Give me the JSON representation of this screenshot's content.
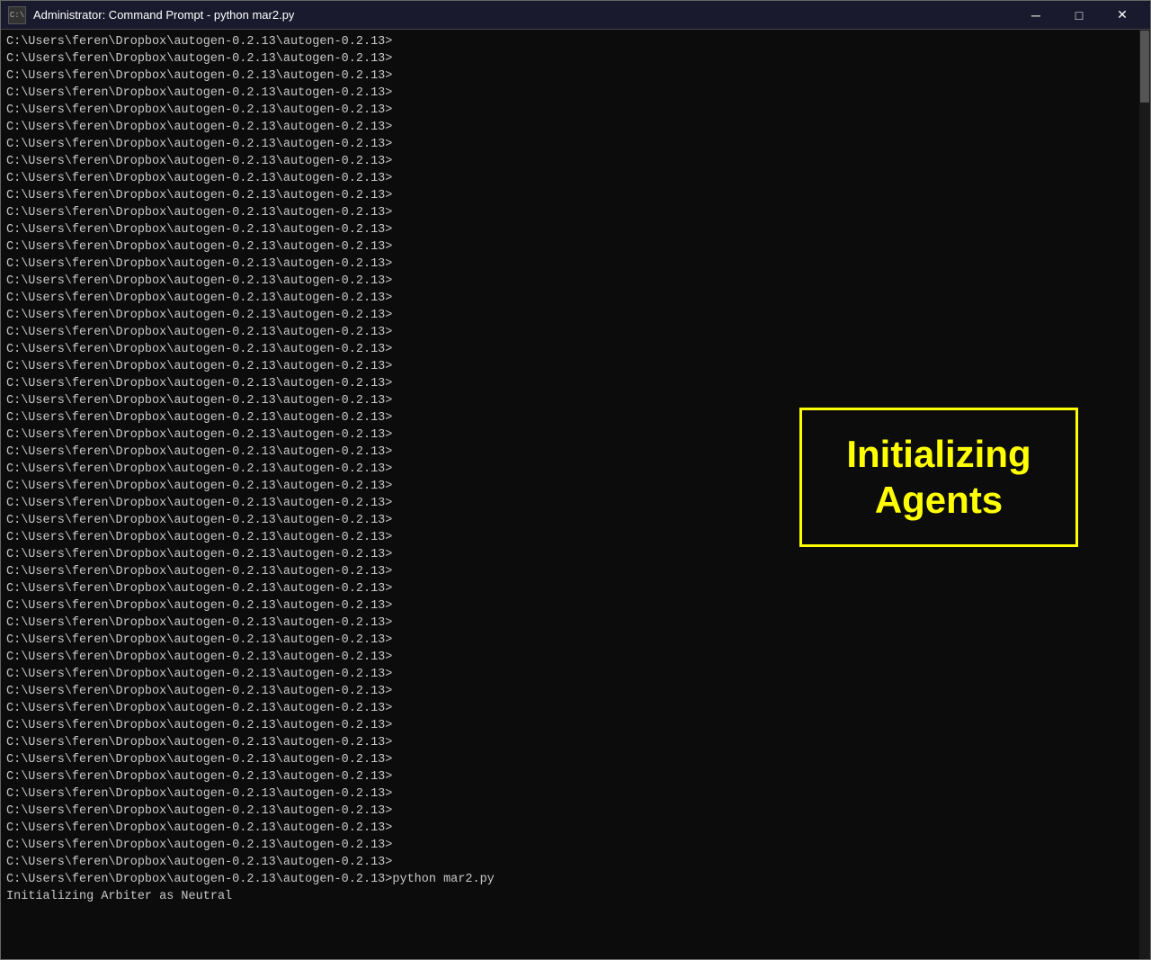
{
  "window": {
    "title": "Administrator: Command Prompt - python  mar2.py",
    "icon_label": "cmd"
  },
  "titlebar": {
    "minimize_label": "─",
    "maximize_label": "□",
    "close_label": "✕"
  },
  "terminal": {
    "prompt_text": "C:\\Users\\feren\\Dropbox\\autogen-0.2.13\\autogen-0.2.13>",
    "last_command": "python mar2.py",
    "last_output": "Initializing Arbiter as Neutral",
    "line_count": 50
  },
  "overlay": {
    "text_line1": "Initializing",
    "text_line2": "Agents",
    "border_color": "#ffff00",
    "text_color": "#ffff00"
  }
}
